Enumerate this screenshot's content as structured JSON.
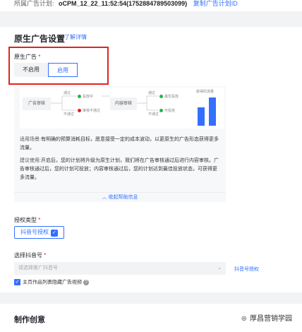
{
  "topbar": {
    "label": "所属广告计划:",
    "plan_name": "oCPM_12_22_11:52:54(1752884789503099)",
    "copy_link": "复制广告计划ID"
  },
  "native_section": {
    "title": "原生广告设置",
    "help_link": "了解详情",
    "field_label": "原生广告",
    "options": [
      "不启用",
      "启用"
    ],
    "selected": "启用"
  },
  "flow": {
    "ad_review": "广告审核",
    "pass": "通过",
    "fail": "不通过",
    "delivering": "投放中",
    "review_failed": "审核不通过",
    "content_review": "内容审核",
    "optimized": "最优投放",
    "deliverable": "可投放",
    "gained_traffic": "获得的流量",
    "status_colors": {
      "green": "#28b34b",
      "red": "#e0231f",
      "blue": "#3370ff"
    }
  },
  "help": {
    "scene_key": "适用场景:",
    "scene_text": "有明确的预算消耗目标，愿意接受一定的成本波动，以更原生的广告形态获得更多流量。",
    "advice_key": "建议使用:",
    "advice_text": "开启后，您的计划将升级为原生计划，我们将在广告审核通过后进行内容审核。广告审核通过后，您的计划可投放；内容审核通过后，您的计划达到最佳投放状态，可获得更多流量。",
    "fold_link": "收起帮助信息"
  },
  "auth": {
    "label": "授权类型",
    "button": "抖音号授权"
  },
  "douyin": {
    "label": "选择抖音号",
    "placeholder": "请选择推广抖音号",
    "side_link": "抖音号授权",
    "checkbox_label": "主页作品列表隐藏广告视频"
  },
  "creative_section": {
    "title": "制作创意"
  },
  "watermark": "厚昌营销学园"
}
